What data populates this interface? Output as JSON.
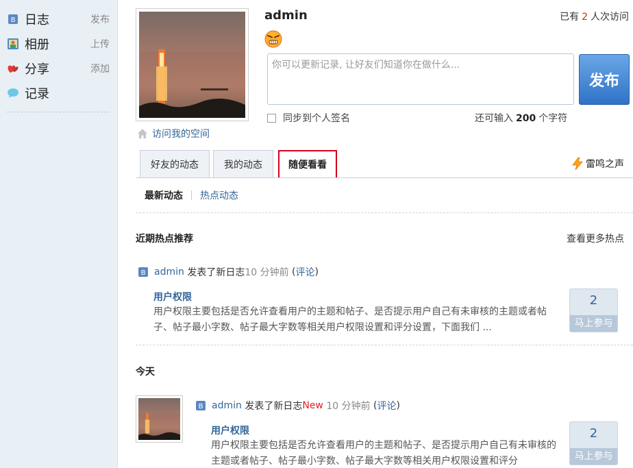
{
  "sidebar": {
    "items": [
      {
        "label": "日志",
        "action": "发布",
        "icon": "blog-icon"
      },
      {
        "label": "相册",
        "action": "上传",
        "icon": "album-icon"
      },
      {
        "label": "分享",
        "action": "添加",
        "icon": "share-icon"
      },
      {
        "label": "记录",
        "action": "",
        "icon": "speech-bubble-icon"
      }
    ]
  },
  "profile": {
    "username": "admin",
    "visit_space": "访问我的空间",
    "visits_prefix": "已有",
    "visits_count": "2",
    "visits_suffix": "人次访问"
  },
  "status": {
    "placeholder": "你可以更新记录, 让好友们知道你在做什么...",
    "publish_label": "发布",
    "sync_label": "同步到个人签名",
    "remain_prefix": "还可输入",
    "remain_count": "200",
    "remain_suffix": "个字符"
  },
  "tabs": [
    {
      "label": "好友的动态"
    },
    {
      "label": "我的动态"
    },
    {
      "label": "随便看看"
    }
  ],
  "thunder_label": "雷鸣之声",
  "subtabs": {
    "latest": "最新动态",
    "hot": "热点动态"
  },
  "hot_section": {
    "title": "近期热点推荐",
    "more": "查看更多热点"
  },
  "feed1": {
    "user": "admin",
    "action": "发表了新日志",
    "time": "10 分钟前",
    "comment_open": "(",
    "comment": "评论",
    "comment_close": ")",
    "title": "用户权限",
    "body": "用户权限主要包括是否允许查看用户的主题和帖子、是否提示用户自己有未审核的主题或者帖子、帖子最小字数、帖子最大字数等相关用户权限设置和评分设置，下面我们 ...",
    "count": "2",
    "join": "马上参与"
  },
  "today_section": {
    "title": "今天"
  },
  "feed2": {
    "user": "admin",
    "action": "发表了新日志",
    "new_tag": "New",
    "time": "10 分钟前",
    "comment_open": "(",
    "comment": "评论",
    "comment_close": ")",
    "title": "用户权限",
    "body": "用户权限主要包括是否允许查看用户的主题和帖子、是否提示用户自己有未审核的主题或者帖子、帖子最小字数、帖子最大字数等相关用户权限设置和评分",
    "count": "2",
    "join": "马上参与"
  }
}
